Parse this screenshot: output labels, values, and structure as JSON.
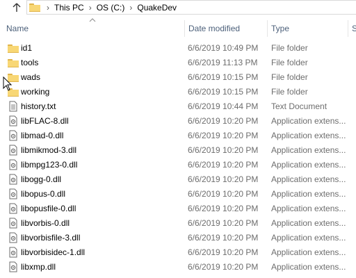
{
  "address": {
    "crumbs": [
      "This PC",
      "OS (C:)",
      "QuakeDev"
    ]
  },
  "columns": {
    "name": "Name",
    "date": "Date modified",
    "type": "Type",
    "size": "S"
  },
  "rows": [
    {
      "name": "id1",
      "date": "6/6/2019 10:49 PM",
      "type": "File folder",
      "icon": "folder-icon"
    },
    {
      "name": "tools",
      "date": "6/6/2019 11:13 PM",
      "type": "File folder",
      "icon": "folder-icon"
    },
    {
      "name": "wads",
      "date": "6/6/2019 10:15 PM",
      "type": "File folder",
      "icon": "folder-icon"
    },
    {
      "name": "working",
      "date": "6/6/2019 10:15 PM",
      "type": "File folder",
      "icon": "folder-icon"
    },
    {
      "name": "history.txt",
      "date": "6/6/2019 10:44 PM",
      "type": "Text Document",
      "icon": "text-file-icon"
    },
    {
      "name": "libFLAC-8.dll",
      "date": "6/6/2019 10:20 PM",
      "type": "Application extens...",
      "icon": "dll-file-icon"
    },
    {
      "name": "libmad-0.dll",
      "date": "6/6/2019 10:20 PM",
      "type": "Application extens...",
      "icon": "dll-file-icon"
    },
    {
      "name": "libmikmod-3.dll",
      "date": "6/6/2019 10:20 PM",
      "type": "Application extens...",
      "icon": "dll-file-icon"
    },
    {
      "name": "libmpg123-0.dll",
      "date": "6/6/2019 10:20 PM",
      "type": "Application extens...",
      "icon": "dll-file-icon"
    },
    {
      "name": "libogg-0.dll",
      "date": "6/6/2019 10:20 PM",
      "type": "Application extens...",
      "icon": "dll-file-icon"
    },
    {
      "name": "libopus-0.dll",
      "date": "6/6/2019 10:20 PM",
      "type": "Application extens...",
      "icon": "dll-file-icon"
    },
    {
      "name": "libopusfile-0.dll",
      "date": "6/6/2019 10:20 PM",
      "type": "Application extens...",
      "icon": "dll-file-icon"
    },
    {
      "name": "libvorbis-0.dll",
      "date": "6/6/2019 10:20 PM",
      "type": "Application extens...",
      "icon": "dll-file-icon"
    },
    {
      "name": "libvorbisfile-3.dll",
      "date": "6/6/2019 10:20 PM",
      "type": "Application extens...",
      "icon": "dll-file-icon"
    },
    {
      "name": "libvorbisidec-1.dll",
      "date": "6/6/2019 10:20 PM",
      "type": "Application extens...",
      "icon": "dll-file-icon"
    },
    {
      "name": "libxmp.dll",
      "date": "6/6/2019 10:20 PM",
      "type": "Application extens...",
      "icon": "dll-file-icon"
    }
  ],
  "colors": {
    "header_text": "#4c607a",
    "folder": "#f8d775",
    "secondary_text": "#6d6d6d"
  }
}
